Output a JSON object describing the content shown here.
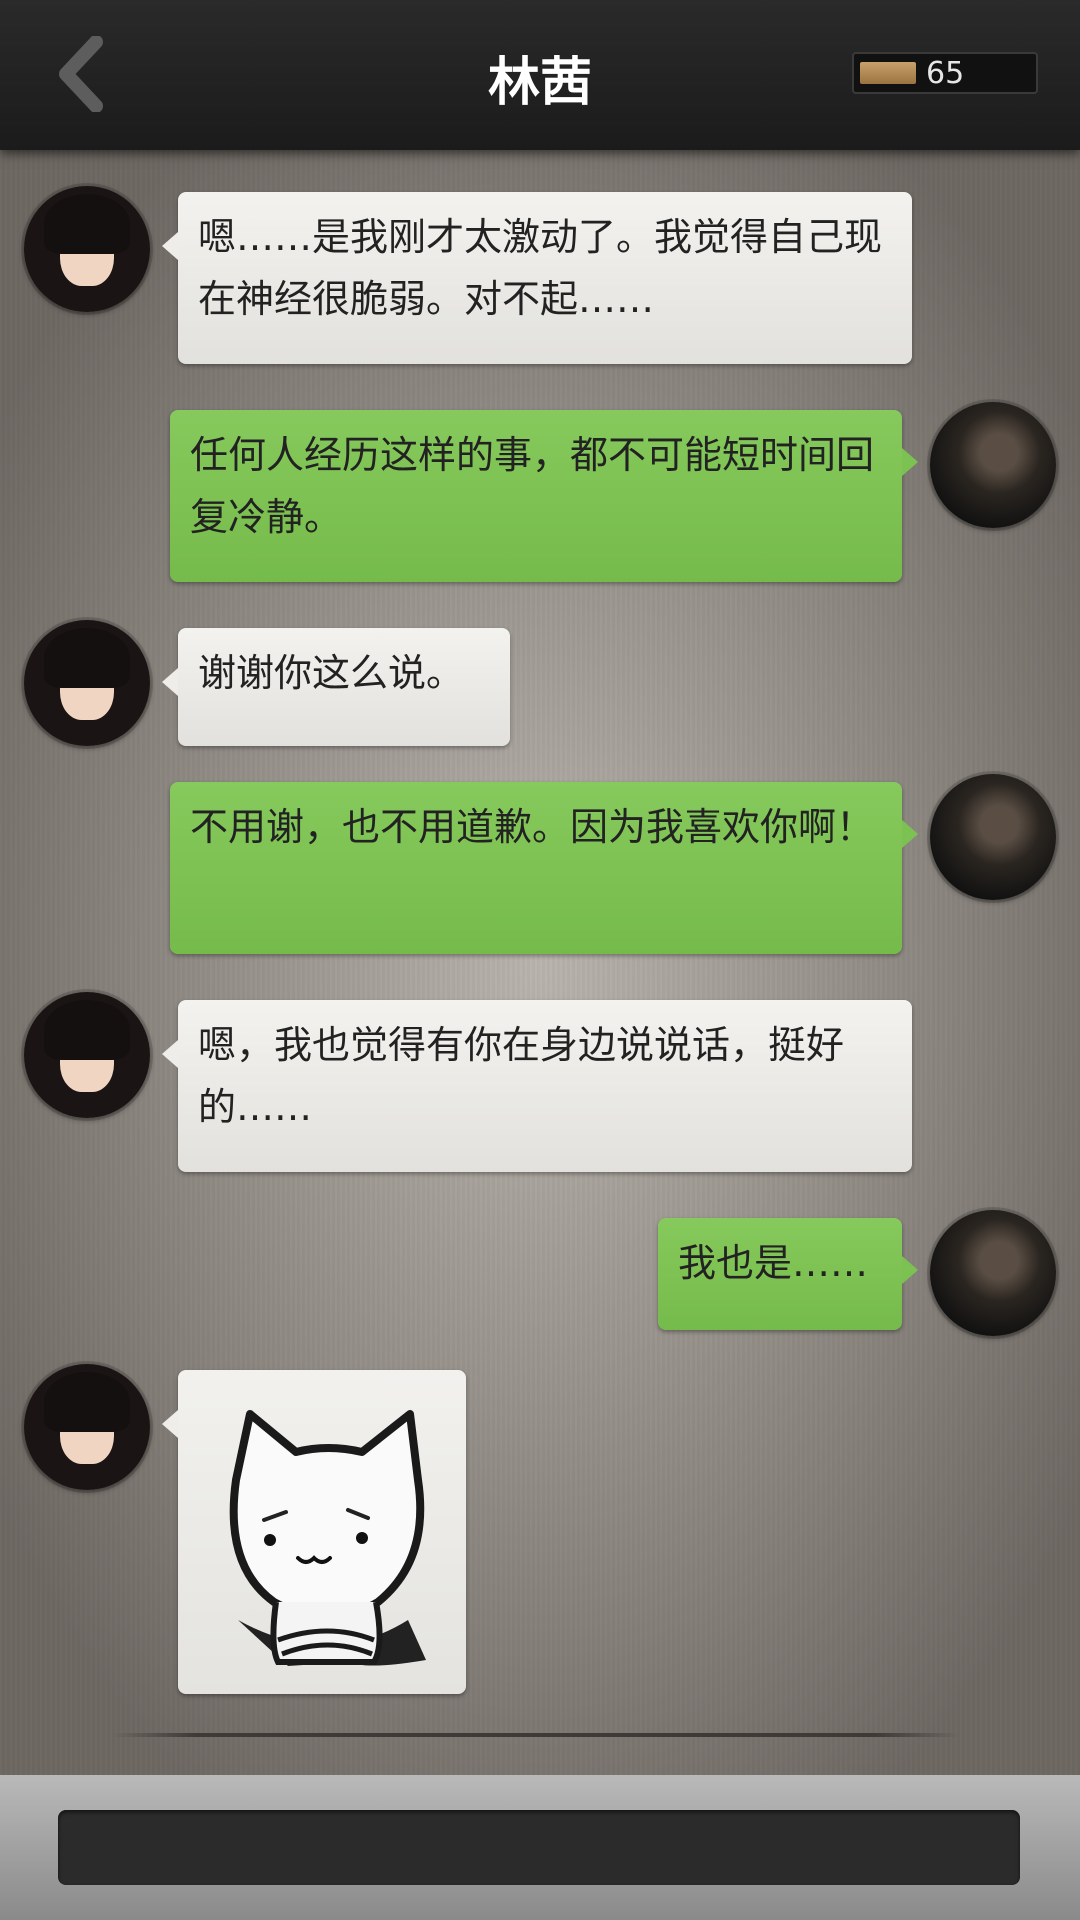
{
  "header": {
    "title": "林茜",
    "coins": "65"
  },
  "messages": [
    {
      "side": "left",
      "text": "嗯……是我刚才太激动了。我觉得自己现在神经很脆弱。对不起……"
    },
    {
      "side": "right",
      "text": "任何人经历这样的事，都不可能短时间回复冷静。"
    },
    {
      "side": "left",
      "text": "谢谢你这么说。"
    },
    {
      "side": "right",
      "text": "不用谢，也不用道歉。因为我喜欢你啊！"
    },
    {
      "side": "left",
      "text": "嗯，我也觉得有你在身边说说话，挺好的……"
    },
    {
      "side": "right",
      "text": "我也是……"
    },
    {
      "side": "left",
      "type": "sticker",
      "sticker": "cat-sticker"
    }
  ],
  "colors": {
    "incoming_bubble": "#eeede9",
    "outgoing_bubble": "#7cc252",
    "header_bg": "#1f1f1f"
  },
  "icons": {
    "back": "back-arrow-icon",
    "coin": "coin-icon"
  }
}
